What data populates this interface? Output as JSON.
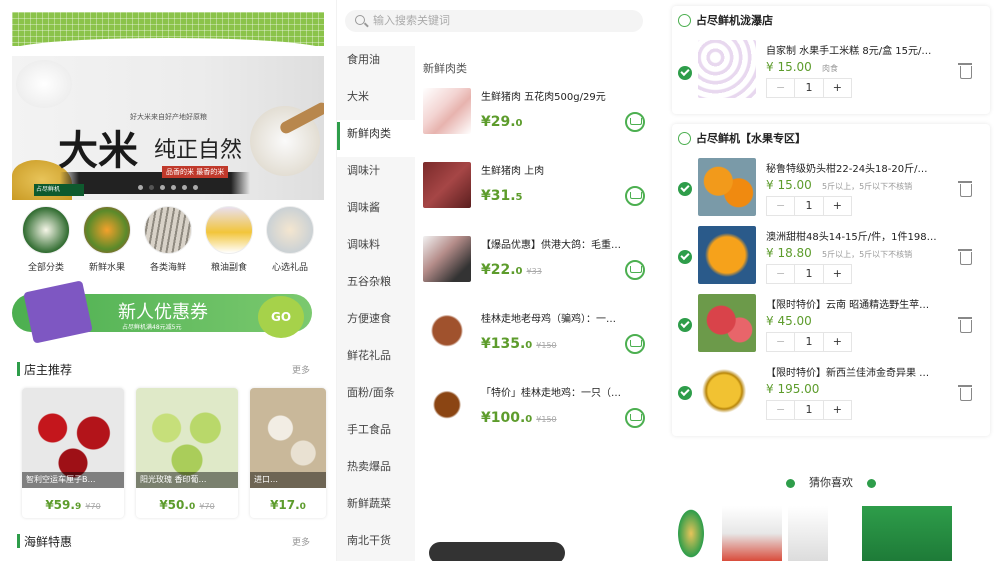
{
  "home": {
    "banner": {
      "headline_big": "大米",
      "headline_small": "纯正自然",
      "tagline": "好大米来自好产地好原粮",
      "sub": "品香的米 最香的米",
      "logo": "占尽鲜机"
    },
    "categories": [
      {
        "label": "全部分类"
      },
      {
        "label": "新鲜水果"
      },
      {
        "label": "各类海鲜"
      },
      {
        "label": "粮油副食"
      },
      {
        "label": "心选礼品"
      }
    ],
    "coupon": {
      "title": "新人优惠券",
      "subline": "占尽鲜机满48元减5元",
      "go": "GO"
    },
    "section1": {
      "title": "店主推荐",
      "more": "更多"
    },
    "recommend": [
      {
        "name": "智利空运车厘子B…",
        "price": "¥59.",
        "price_dec": "9",
        "old": "¥70"
      },
      {
        "name": "阳光玫瑰 香印葡…",
        "price": "¥50.",
        "price_dec": "0",
        "old": "¥70"
      },
      {
        "name": "进口…",
        "price": "¥17.",
        "price_dec": "0",
        "old": ""
      }
    ],
    "section2": {
      "title": "海鲜特惠",
      "more": "更多"
    }
  },
  "category_page": {
    "search_placeholder": "输入搜索关键词",
    "sidebar": [
      "食用油",
      "大米",
      "新鲜肉类",
      "调味汁",
      "调味酱",
      "调味料",
      "五谷杂粮",
      "方便速食",
      "鲜花礼品",
      "面粉/面条",
      "手工食品",
      "热卖爆品",
      "新鲜蔬菜",
      "南北干货"
    ],
    "active_index": 2,
    "list_title": "新鲜肉类",
    "products": [
      {
        "name": "生鲜猪肉 五花肉500g/29元",
        "price": "¥29.",
        "dec": "0",
        "old": ""
      },
      {
        "name": "生鲜猪肉 上肉",
        "price": "¥31.",
        "dec": "5",
        "old": ""
      },
      {
        "name": "【爆品优惠】供港大鸽：毛重…",
        "price": "¥22.",
        "dec": "0",
        "old": "¥33"
      },
      {
        "name": "桂林走地老母鸡（骗鸡）：一…",
        "price": "¥135.",
        "dec": "0",
        "old": "¥150"
      },
      {
        "name": "「特价」桂林走地鸡：一只（…",
        "price": "¥100.",
        "dec": "0",
        "old": "¥150"
      }
    ]
  },
  "cart": {
    "stores": [
      {
        "name": "占尽鲜机泷瀑店",
        "items": [
          {
            "name": "自家制 水果手工米糕 8元/盒 15元/…",
            "price": "¥ 15.00",
            "note": "肉食",
            "qty": "1"
          }
        ]
      },
      {
        "name": "占尽鲜机【水果专区】",
        "items": [
          {
            "name": "秘鲁特级奶头柑22-24头18-20斤/…",
            "price": "¥ 15.00",
            "note": "5斤以上，5斤以下不核销",
            "qty": "1"
          },
          {
            "name": "澳洲甜柑48头14-15斤/件，1件198…",
            "price": "¥ 18.80",
            "note": "5斤以上，5斤以下不核销",
            "qty": "1"
          },
          {
            "name": "【限时特价】云南 昭通精选野生苹…",
            "price": "¥ 45.00",
            "note": "",
            "qty": "1"
          },
          {
            "name": "【限时特价】新西兰佳沛金奇异果 …",
            "price": "¥ 195.00",
            "note": "",
            "qty": "1"
          }
        ]
      }
    ],
    "minus": "−",
    "plus": "+",
    "guess_title": "猜你喜欢"
  }
}
